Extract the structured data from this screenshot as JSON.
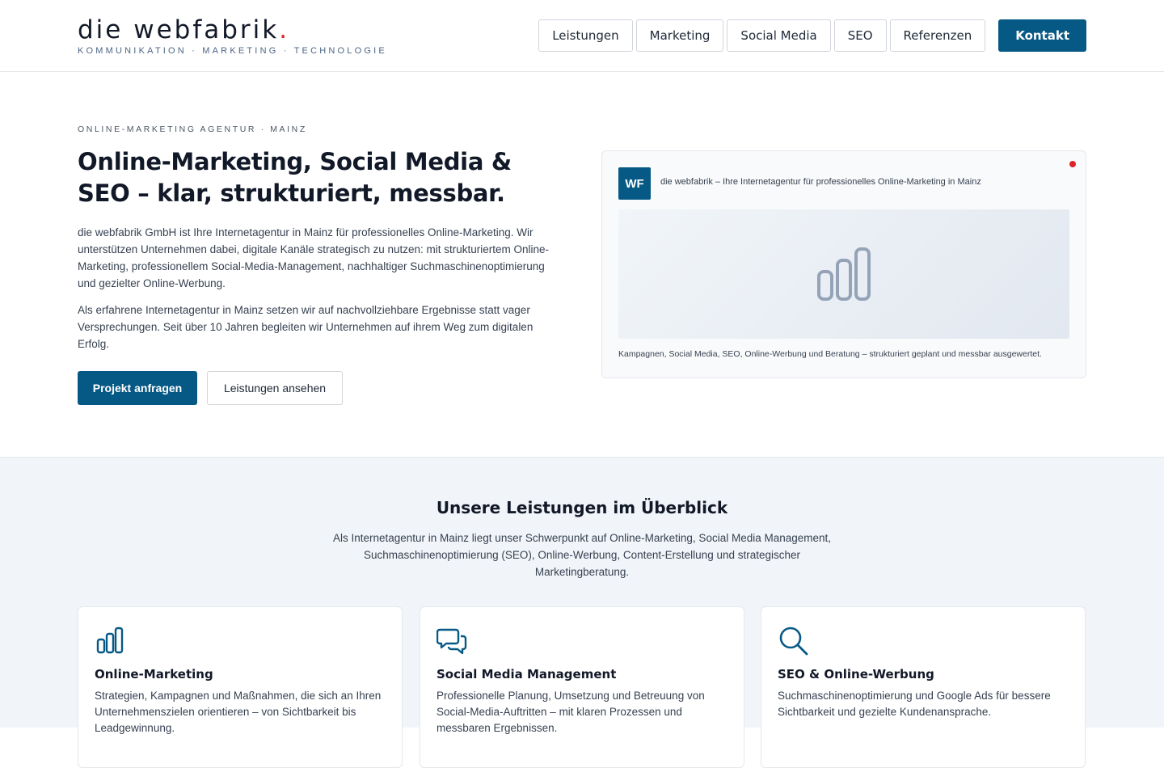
{
  "brand": {
    "name": "die webfabrik",
    "dot": ".",
    "tagline": "KOMMUNIKATION · MARKETING · TECHNOLOGIE",
    "accent": "#075985",
    "dot_color": "#dc2626"
  },
  "nav": {
    "items": [
      {
        "label": "Leistungen"
      },
      {
        "label": "Marketing"
      },
      {
        "label": "Social Media"
      },
      {
        "label": "SEO"
      },
      {
        "label": "Referenzen"
      }
    ],
    "cta": "Kontakt"
  },
  "hero": {
    "eyebrow": "ONLINE-MARKETING AGENTUR · MAINZ",
    "title": "Online-Marketing, Social Media & SEO – klar, strukturiert, messbar.",
    "paragraph1": "die webfabrik GmbH ist Ihre Internetagentur in Mainz für professionelles Online-Marketing. Wir unterstützen Unternehmen dabei, digitale Kanäle strategisch zu nutzen: mit strukturiertem Online-Marketing, professionellem Social-Media-Management, nachhaltiger Suchmaschinenoptimierung und gezielter Online-Werbung.",
    "paragraph2": "Als erfahrene Internetagentur in Mainz setzen wir auf nachvollziehbare Ergebnisse statt vager Versprechungen. Seit über 10 Jahren begleiten wir Unternehmen auf ihrem Weg zum digitalen Erfolg.",
    "primary_button": "Projekt anfragen",
    "secondary_button": "Leistungen ansehen"
  },
  "card": {
    "badge": "WF",
    "header": "die webfabrik – Ihre Internetagentur für professionelles Online-Marketing in Mainz",
    "visual_icon": "bar-chart-icon",
    "caption": "Kampagnen, Social Media, SEO, Online-Werbung und Beratung – strukturiert geplant und messbar ausgewertet."
  },
  "services": {
    "title": "Unsere Leistungen im Überblick",
    "intro": "Als Internetagentur in Mainz liegt unser Schwerpunkt auf Online-Marketing, Social Media Management, Suchmaschinenoptimierung (SEO), Online-Werbung, Content-Erstellung und strategischer Marketingberatung.",
    "items": [
      {
        "icon": "bar-chart-icon",
        "title": "Online-Marketing",
        "text": "Strategien, Kampagnen und Maßnahmen, die sich an Ihren Unternehmenszielen orientieren – von Sichtbarkeit bis Leadgewinnung."
      },
      {
        "icon": "chat-bubbles-icon",
        "title": "Social Media Management",
        "text": "Professionelle Planung, Umsetzung und Betreuung von Social-Media-Auftritten – mit klaren Prozessen und messbaren Ergebnissen."
      },
      {
        "icon": "search-icon",
        "title": "SEO & Online-Werbung",
        "text": "Suchmaschinenoptimierung und Google Ads für bessere Sichtbarkeit und gezielte Kundenansprache."
      }
    ]
  }
}
